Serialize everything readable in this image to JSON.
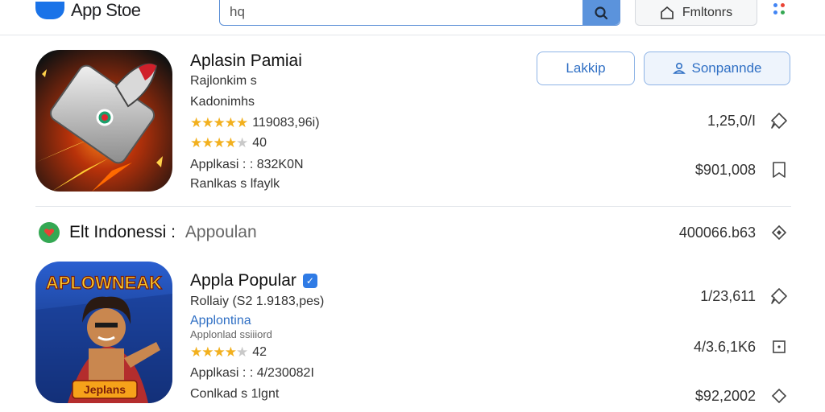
{
  "header": {
    "app_name": "App Stoe",
    "search": {
      "value": "hq",
      "placeholder": ""
    },
    "filter_label": "Fmltonrs"
  },
  "featured": {
    "title": "Aplasin Pamiai",
    "subtitle1": "Rajlonkim s",
    "subtitle2": "Kadonimhs",
    "rating_stars": 4.5,
    "rating_text": "119083,96i)",
    "rating2_stars": 4,
    "rating2_text": "40",
    "info1": "Applkasi : : 832K0N",
    "info2": "Ranlkas s lfaylk",
    "button_secondary": "Lakkip",
    "button_primary": "Sonpannde",
    "metric1": "1,25,0/I",
    "metric2": "$901,008"
  },
  "region": {
    "label": "Elt Indonessi :",
    "category": "Appoulan",
    "metric": "400066.b63"
  },
  "second": {
    "title": "Appla Popular",
    "verified": true,
    "subtitle1": "Rollaiy (S2 1.9183,pes)",
    "developer": "Applontina",
    "subtitle3": "Applonlad ssiiiord",
    "rating_stars": 4.5,
    "rating_text": "42",
    "info1": "Applkasi : : 4/230082I",
    "info2": "Conlkad s 1lgnt",
    "icon_banner": "APLOWNEAK",
    "icon_caption": "Jeplans",
    "metric1": "1/23,611",
    "metric2": "4/3.6,1K6",
    "metric3": "$92,2002"
  },
  "colors": {
    "accent": "#2f6fc4",
    "star": "#f2b01e",
    "brand": "#1a73e8"
  }
}
